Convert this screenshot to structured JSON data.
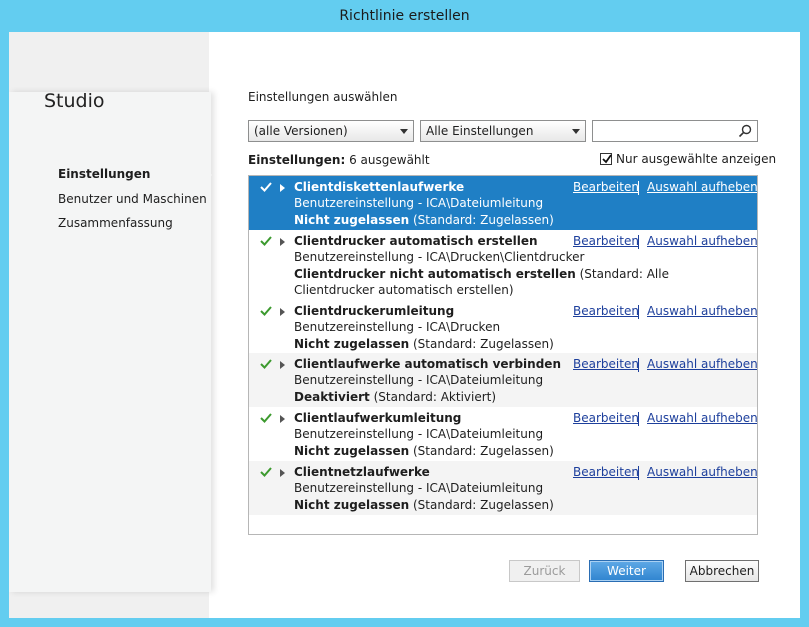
{
  "window": {
    "title": "Richtlinie erstellen"
  },
  "sidebar": {
    "app_title": "Studio",
    "items": [
      {
        "label": "Einstellungen",
        "active": true
      },
      {
        "label": "Benutzer und Maschinen",
        "active": false
      },
      {
        "label": "Zusammenfassung",
        "active": false
      }
    ]
  },
  "main": {
    "heading": "Einstellungen auswählen",
    "version_filter": "(alle Versionen)",
    "category_filter": "Alle Einstellungen",
    "search": {
      "value": "",
      "placeholder": ""
    },
    "count_label": "Einstellungen:",
    "count_value": "6 ausgewählt",
    "only_selected_label": "Nur ausgewählte anzeigen",
    "only_selected_checked": true
  },
  "settings": [
    {
      "title": "Clientdiskettenlaufwerke",
      "path": "Benutzereinstellung - ICA\\Dateiumleitung",
      "value": "Nicht zugelassen",
      "default": "(Standard: Zugelassen)",
      "edit": "Bearbeiten",
      "remove": "Auswahl aufheben"
    },
    {
      "title": "Clientdrucker automatisch erstellen",
      "path": "Benutzereinstellung - ICA\\Drucken\\Clientdrucker",
      "value": "Clientdrucker nicht automatisch erstellen",
      "default": "(Standard: Alle Clientdrucker automatisch erstellen)",
      "edit": "Bearbeiten",
      "remove": "Auswahl aufheben"
    },
    {
      "title": "Clientdruckerumleitung",
      "path": "Benutzereinstellung - ICA\\Drucken",
      "value": "Nicht zugelassen",
      "default": "(Standard: Zugelassen)",
      "edit": "Bearbeiten",
      "remove": "Auswahl aufheben"
    },
    {
      "title": "Clientlaufwerke automatisch verbinden",
      "path": "Benutzereinstellung - ICA\\Dateiumleitung",
      "value": "Deaktiviert",
      "default": "(Standard: Aktiviert)",
      "edit": "Bearbeiten",
      "remove": "Auswahl aufheben"
    },
    {
      "title": "Clientlaufwerkumleitung",
      "path": "Benutzereinstellung - ICA\\Dateiumleitung",
      "value": "Nicht zugelassen",
      "default": "(Standard: Zugelassen)",
      "edit": "Bearbeiten",
      "remove": "Auswahl aufheben"
    },
    {
      "title": "Clientnetzlaufwerke",
      "path": "Benutzereinstellung - ICA\\Dateiumleitung",
      "value": "Nicht zugelassen",
      "default": "(Standard: Zugelassen)",
      "edit": "Bearbeiten",
      "remove": "Auswahl aufheben"
    }
  ],
  "footer": {
    "back": "Zurück",
    "next": "Weiter",
    "cancel": "Abbrechen"
  },
  "colors": {
    "titlebar": "#63cdf0",
    "selected_row": "#1f7fc5",
    "check_green": "#3c9a2e",
    "link": "#1d3f9c"
  }
}
